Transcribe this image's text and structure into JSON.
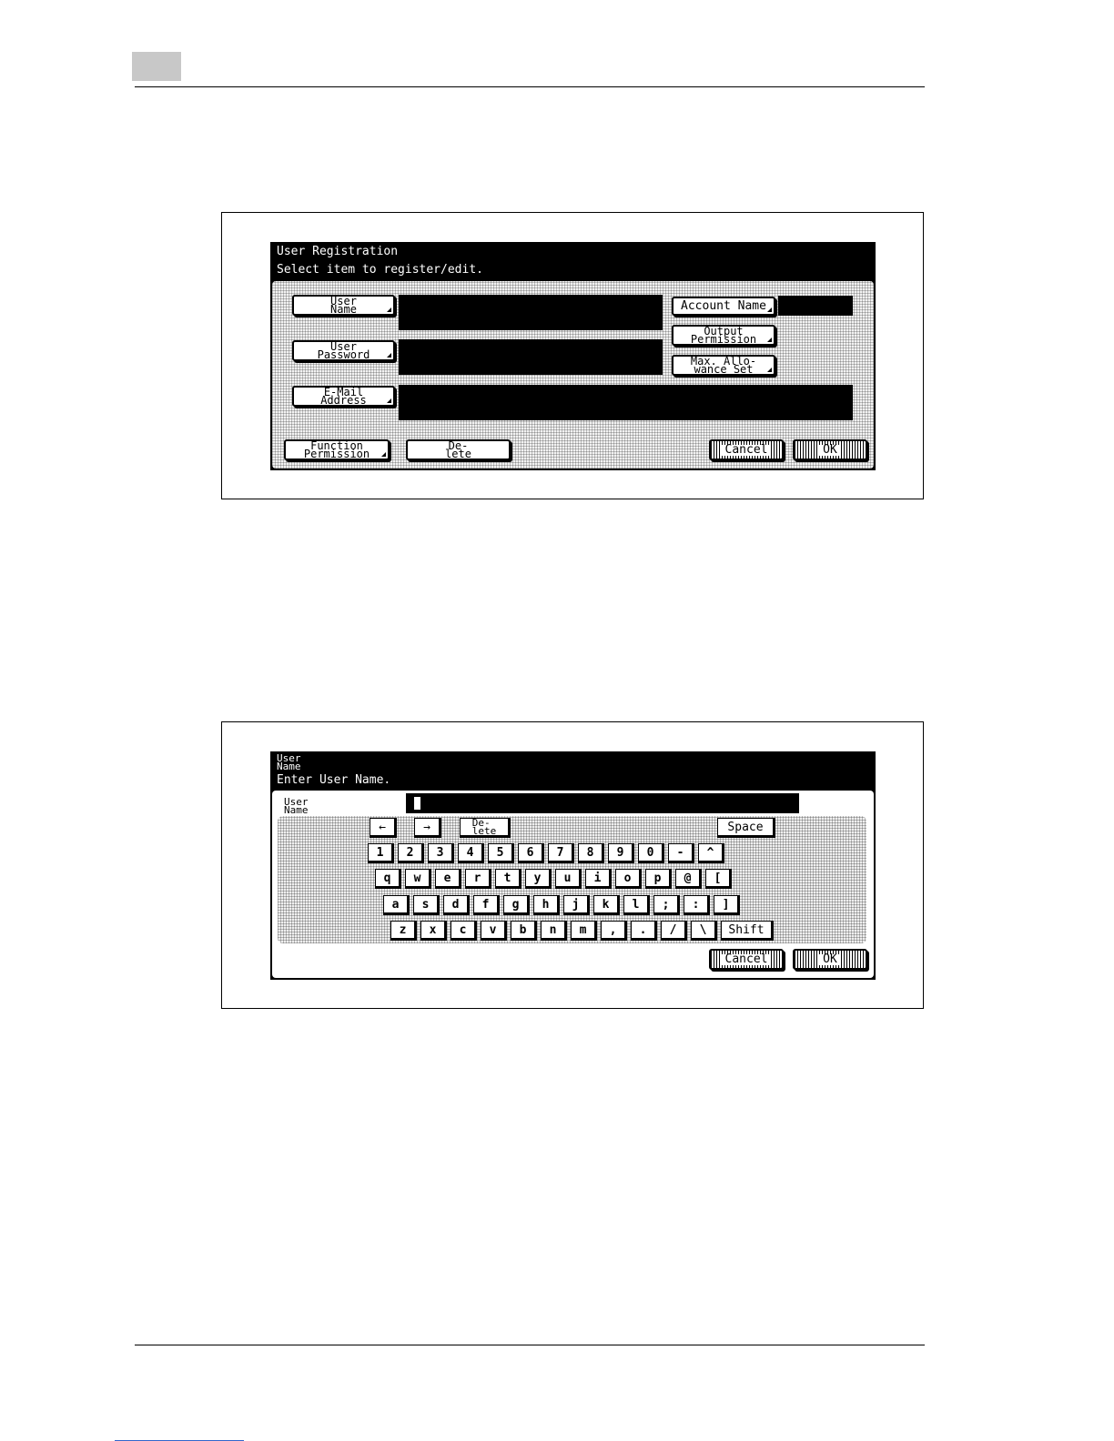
{
  "screen1": {
    "title": "User Registration",
    "subtitle": "Select item to register/edit.",
    "buttons": {
      "user_name": "User\nName",
      "user_password": "User\nPassword",
      "email_address": "E-Mail\nAddress",
      "account_name": "Account Name",
      "output_permission": "Output\nPermission",
      "max_allowance": "Max. Allo-\nwance Set",
      "function_permission": "Function\nPermission",
      "delete": "De-\nlete",
      "cancel": "Cancel",
      "ok": "OK"
    },
    "fields": {
      "user_name_value": "",
      "user_password_value": "",
      "email_address_value": "",
      "account_name_value": ""
    }
  },
  "screen2": {
    "title": "User\nName",
    "subtitle": "Enter User Name.",
    "field_label": "User\nName",
    "field_value": "",
    "controls": {
      "left_arrow": "←",
      "right_arrow": "→",
      "delete": "De-\nlete",
      "space": "Space",
      "shift": "Shift",
      "cancel": "Cancel",
      "ok": "OK"
    },
    "keyboard": {
      "row1": [
        "1",
        "2",
        "3",
        "4",
        "5",
        "6",
        "7",
        "8",
        "9",
        "0",
        "-",
        "^"
      ],
      "row2": [
        "q",
        "w",
        "e",
        "r",
        "t",
        "y",
        "u",
        "i",
        "o",
        "p",
        "@",
        "["
      ],
      "row3": [
        "a",
        "s",
        "d",
        "f",
        "g",
        "h",
        "j",
        "k",
        "l",
        ";",
        ":",
        "]"
      ],
      "row4": [
        "z",
        "x",
        "c",
        "v",
        "b",
        "n",
        "m",
        ",",
        ".",
        "/",
        "\\"
      ]
    }
  }
}
